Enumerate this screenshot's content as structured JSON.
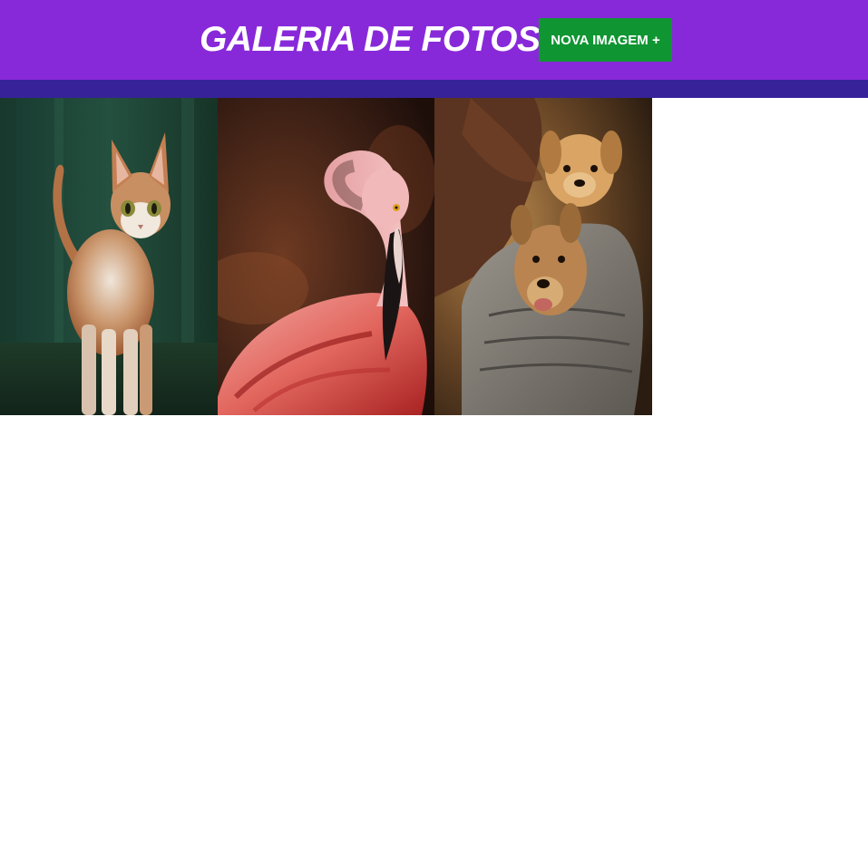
{
  "header": {
    "title": "GALERIA DE FOTOS",
    "new_button_label": "NOVA IMAGEM +",
    "background_color": "#8829d9",
    "button_color": "#0f9532"
  },
  "subbar": {
    "color": "#37229a"
  },
  "gallery": {
    "photos": [
      {
        "subject": "cat"
      },
      {
        "subject": "flamingo"
      },
      {
        "subject": "puppies"
      }
    ]
  }
}
